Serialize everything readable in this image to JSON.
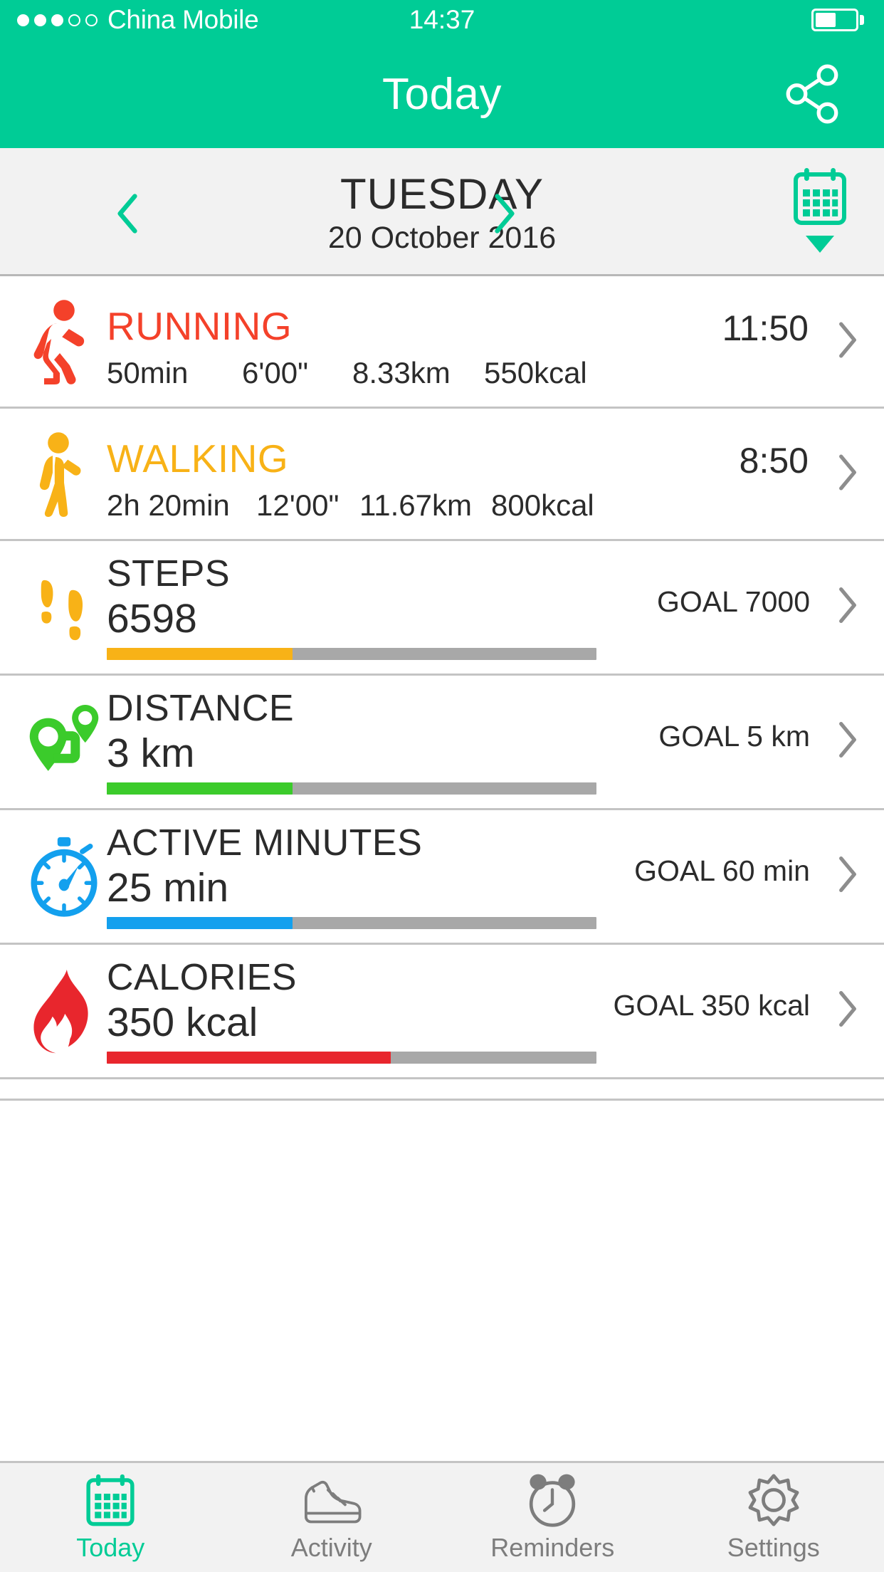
{
  "status_bar": {
    "carrier": "China Mobile",
    "time": "14:37",
    "signal_dots_filled": 3,
    "signal_dots_total": 5,
    "battery_level_pct": 52
  },
  "header": {
    "title": "Today",
    "share_icon": "share-icon",
    "background_color": "#00CC96"
  },
  "date_bar": {
    "prev_icon": "chevron-left-icon",
    "next_icon": "chevron-right-icon",
    "day_name": "TUESDAY",
    "date": "20 October 2016",
    "calendar_icon": "calendar-icon",
    "calendar_dropdown_icon": "triangle-down-icon"
  },
  "activities": [
    {
      "name": "RUNNING",
      "icon": "running-person-icon",
      "color": "#F4412A",
      "time": "11:50",
      "stats": [
        "50min",
        "6'00\"",
        "8.33km",
        "550kcal"
      ],
      "chevron": "chevron-right-icon"
    },
    {
      "name": "WALKING",
      "icon": "walking-person-icon",
      "color": "#F8B217",
      "time": "8:50",
      "stats": [
        "2h 20min",
        "12'00\"",
        "11.67km",
        "800kcal"
      ],
      "chevron": "chevron-right-icon"
    }
  ],
  "goals": [
    {
      "title": "STEPS",
      "value": "6598",
      "goal": "GOAL 7000",
      "icon": "footprints-icon",
      "color": "#F8B217",
      "progress_pct": 38,
      "chevron": "chevron-right-icon"
    },
    {
      "title": "DISTANCE",
      "value": "3 km",
      "goal": "GOAL 5 km",
      "icon": "route-pin-icon",
      "color": "#3BCB2B",
      "progress_pct": 38,
      "chevron": "chevron-right-icon"
    },
    {
      "title": "ACTIVE MINUTES",
      "value": "25 min",
      "goal": "GOAL 60 min",
      "icon": "stopwatch-icon",
      "color": "#13A0EE",
      "progress_pct": 38,
      "chevron": "chevron-right-icon"
    },
    {
      "title": "CALORIES",
      "value": "350 kcal",
      "goal": "GOAL 350 kcal",
      "icon": "flame-icon",
      "color": "#E8262D",
      "progress_pct": 58,
      "chevron": "chevron-right-icon"
    }
  ],
  "tab_bar": {
    "active_color": "#00CC96",
    "inactive_color": "#7d7d7d",
    "tabs": [
      {
        "label": "Today",
        "icon": "calendar-icon",
        "active": true
      },
      {
        "label": "Activity",
        "icon": "sneaker-icon",
        "active": false
      },
      {
        "label": "Reminders",
        "icon": "alarm-clock-icon",
        "active": false
      },
      {
        "label": "Settings",
        "icon": "gear-icon",
        "active": false
      }
    ]
  }
}
